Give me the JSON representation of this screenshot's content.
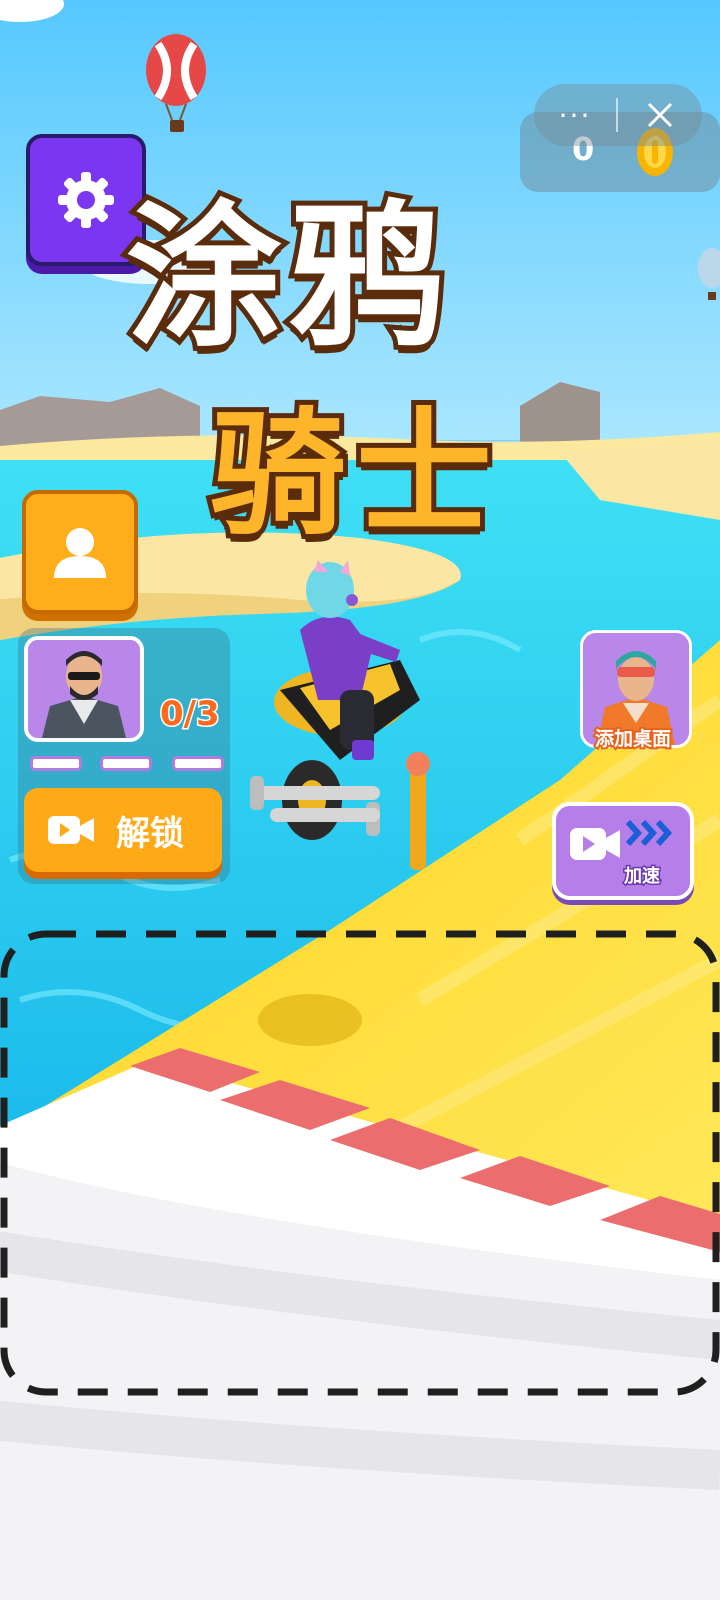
{
  "hud": {
    "capsule_more": "···",
    "coin_count": "0"
  },
  "title": {
    "line1": "涂鸦",
    "line2": "骑士"
  },
  "unlock": {
    "progress": "0/3",
    "button_label": "解锁"
  },
  "side": {
    "add_desktop_label": "添加桌面",
    "speed_label": "加速"
  },
  "icons": [
    "gear-icon",
    "user-icon",
    "video-icon",
    "close-icon",
    "coin-icon",
    "chevrons-icon"
  ],
  "colors": {
    "settings_purple": "#7a36f0",
    "profile_orange": "#ffad1a",
    "unlock_orange": "#ffa916",
    "title_orange": "#ffb52a",
    "track_yellow": "#ffe23a",
    "water_blue": "#2fd2f0"
  }
}
